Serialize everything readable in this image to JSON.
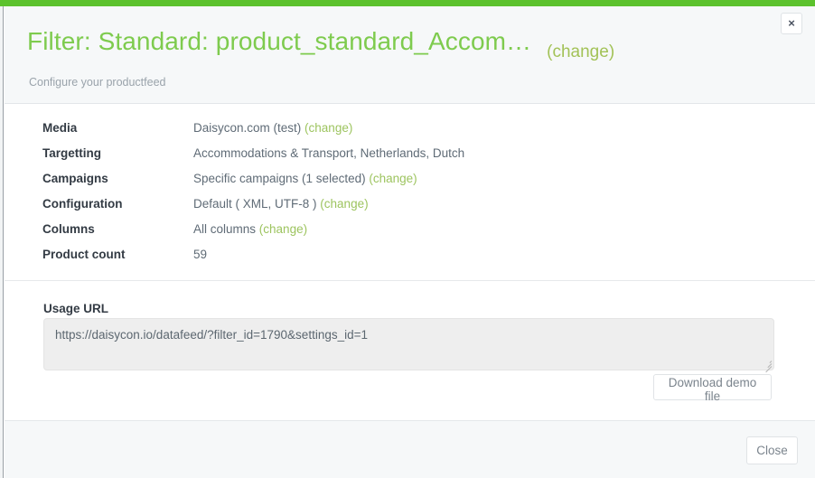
{
  "accent_color": "#5cc22d",
  "header": {
    "title": "Filter: Standard: product_standard_Accom…",
    "title_change_label": "(change)",
    "subtitle": "Configure your productfeed",
    "close_icon": "×"
  },
  "details": {
    "rows": [
      {
        "label": "Media",
        "value": "Daisycon.com (test)",
        "change_label": "(change)"
      },
      {
        "label": "Targetting",
        "value": "Accommodations & Transport, Netherlands, Dutch",
        "change_label": ""
      },
      {
        "label": "Campaigns",
        "value": "Specific campaigns (1 selected)",
        "change_label": "(change)"
      },
      {
        "label": "Configuration",
        "value": "Default ( XML, UTF-8 )",
        "change_label": "(change)"
      },
      {
        "label": "Columns",
        "value": "All columns",
        "change_label": "(change)"
      },
      {
        "label": "Product count",
        "value": "59",
        "change_label": ""
      }
    ]
  },
  "usage": {
    "label": "Usage URL",
    "url": "https://daisycon.io/datafeed/?filter_id=1790&settings_id=1",
    "download_label": "Download demo file"
  },
  "footer": {
    "close_label": "Close"
  }
}
